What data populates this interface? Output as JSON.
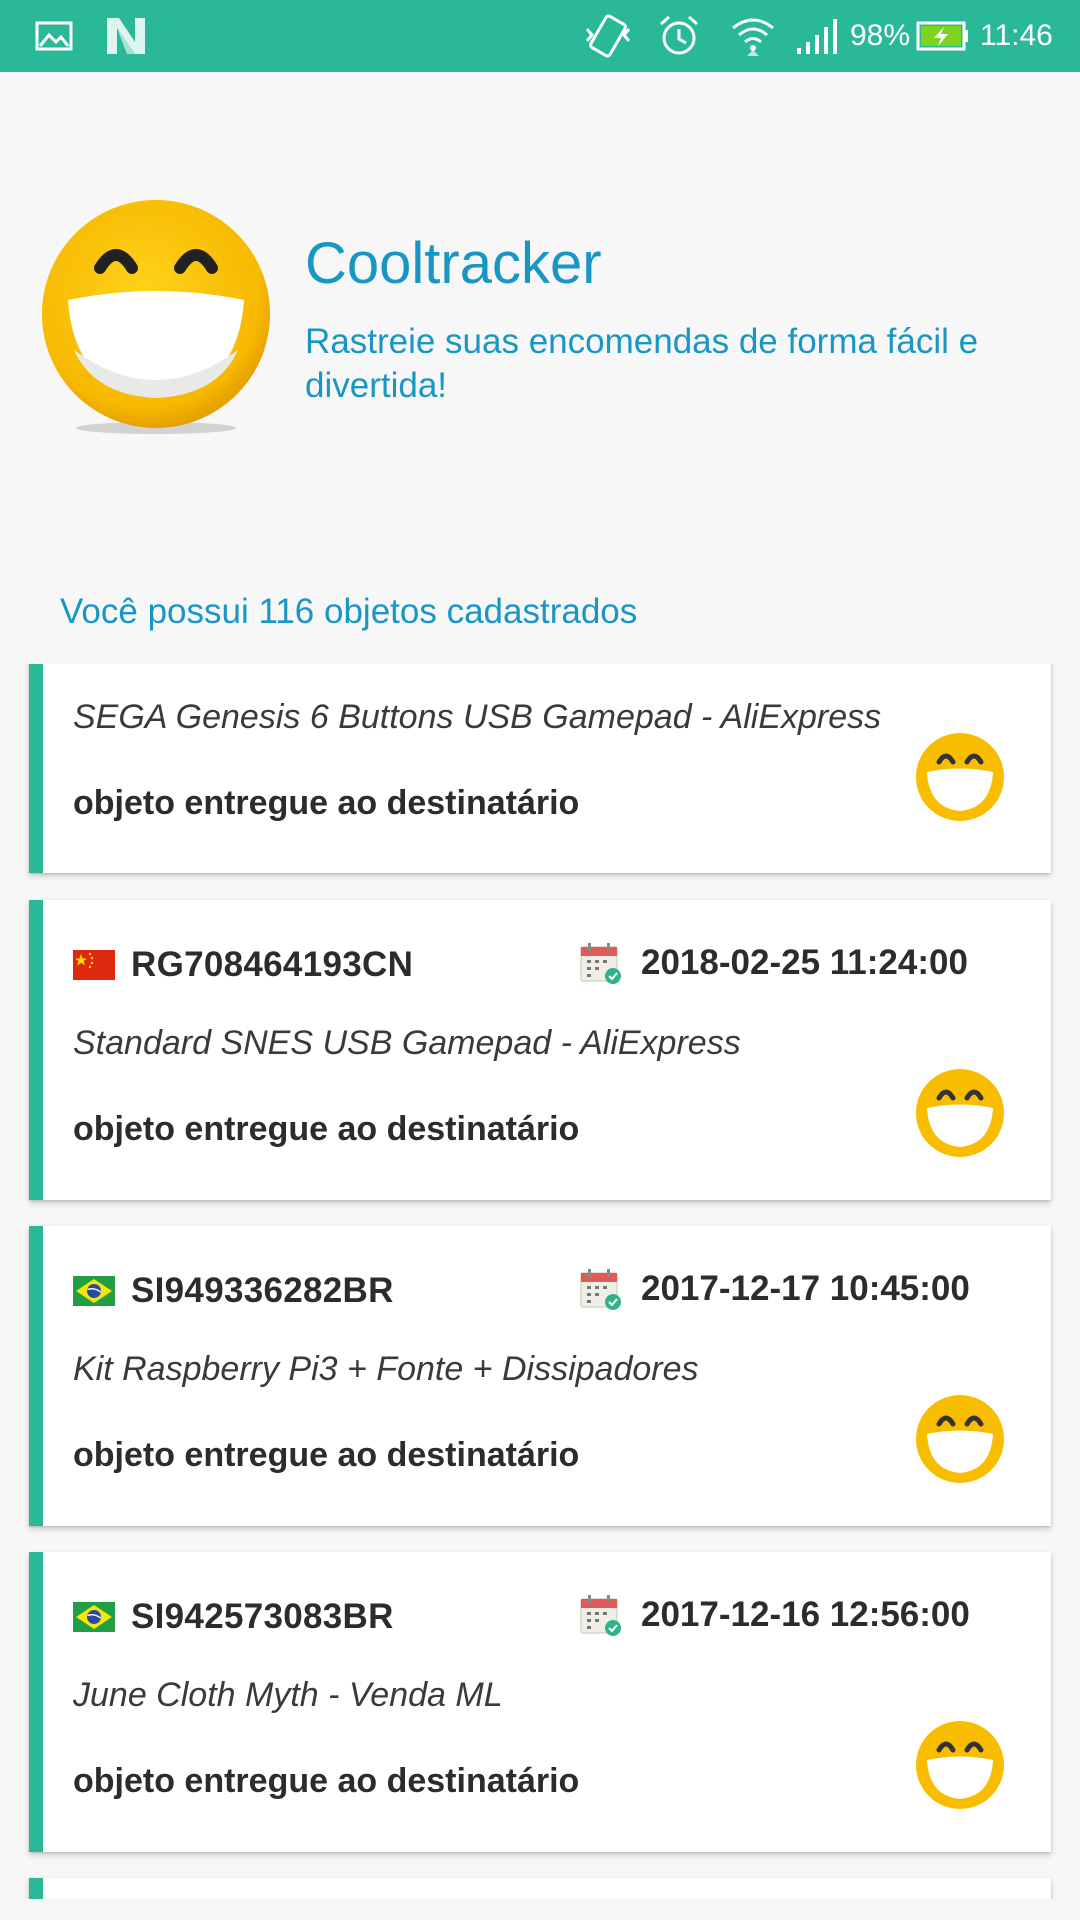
{
  "status_bar": {
    "battery": "98%",
    "time": "11:46"
  },
  "header": {
    "title": "Cooltracker",
    "subtitle": "Rastreie suas encomendas de forma fácil e divertida!",
    "count_text": "Você possui 116 objetos cadastrados"
  },
  "packages": [
    {
      "code": "",
      "date": "",
      "description": "SEGA Genesis 6 Buttons USB Gamepad - AliExpress",
      "status": "objeto entregue ao destinatário",
      "flag": ""
    },
    {
      "code": "RG708464193CN",
      "date": "2018-02-25 11:24:00",
      "description": "Standard SNES USB Gamepad - AliExpress",
      "status": "objeto entregue ao destinatário",
      "flag": "china-flag-icon"
    },
    {
      "code": "SI949336282BR",
      "date": "2017-12-17 10:45:00",
      "description": "Kit Raspberry Pi3 + Fonte + Dissipadores",
      "status": "objeto entregue ao destinatário",
      "flag": "brazil-flag-icon"
    },
    {
      "code": "SI942573083BR",
      "date": "2017-12-16 12:56:00",
      "description": "June Cloth Myth - Venda ML",
      "status": "objeto entregue ao destinatário",
      "flag": "brazil-flag-icon"
    }
  ],
  "colors": {
    "accent": "#29b898",
    "title_blue": "#1896c4"
  }
}
